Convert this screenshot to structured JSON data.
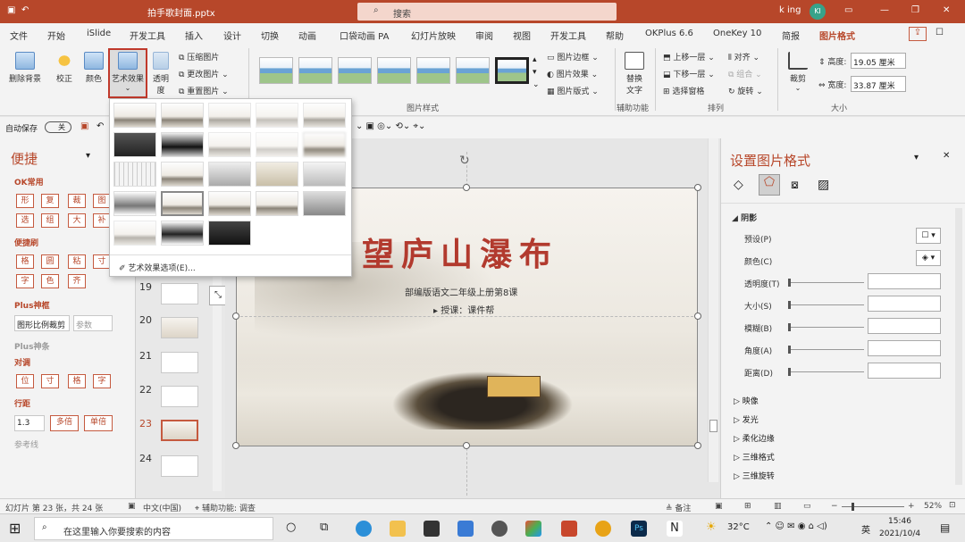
{
  "titlebar": {
    "filename": "拍手歌封面.pptx",
    "search_placeholder": "搜索",
    "user": "k ing",
    "avatar": "KI"
  },
  "menu": [
    "文件",
    "开始",
    "iSlide",
    "开发工具",
    "插入",
    "设计",
    "切换",
    "动画",
    "口袋动画 PA",
    "幻灯片放映",
    "审阅",
    "视图",
    "开发工具",
    "帮助",
    "OKPlus 6.6",
    "OneKey 10",
    "简报",
    "图片格式"
  ],
  "ribbon": {
    "remove_bg": "删除背景",
    "correct": "校正",
    "color": "颜色",
    "art_effects": "艺术效果",
    "transparency": "透明度",
    "compress": "压缩图片",
    "change": "更改图片",
    "reset": "重置图片",
    "picture_border": "图片边框",
    "picture_effects": "图片效果",
    "picture_layout": "图片版式",
    "alt_text": "替换文字",
    "bring_forward": "上移一层",
    "send_backward": "下移一层",
    "selection_pane": "选择窗格",
    "align": "对齐",
    "group": "组合",
    "rotate": "旋转",
    "crop": "裁剪",
    "height_label": "高度:",
    "height_value": "19.05 厘米",
    "width_label": "宽度:",
    "width_value": "33.87 厘米",
    "group_styles": "图片样式",
    "group_accessibility": "辅助功能",
    "group_arrange": "排列",
    "group_size": "大小"
  },
  "qat": {
    "autosave": "自动保存",
    "toggle": "关"
  },
  "dropdown": {
    "option_label": "艺术效果选项(E)..."
  },
  "leftpane": {
    "title": "便捷",
    "sec1": "OK常用",
    "row1": [
      "形",
      "复",
      "裁",
      "图"
    ],
    "row2": [
      "选",
      "组",
      "大",
      "补"
    ],
    "sec2": "便捷刷",
    "row3": [
      "格",
      "圆",
      "粘",
      "寸"
    ],
    "row4": [
      "字",
      "色",
      "齐"
    ],
    "sec3": "Plus神框",
    "crop_ratio": "图形比例裁剪",
    "param_placeholder": "参数",
    "sec4": "Plus神条",
    "sec5": "对调",
    "row5": [
      "位",
      "寸",
      "格",
      "字"
    ],
    "sec6": "行距",
    "spacing_value": "1.3",
    "multi": "多倍",
    "single": "单倍",
    "ref": "参考线"
  },
  "thumbnails": [
    "19",
    "20",
    "21",
    "22",
    "23",
    "24"
  ],
  "slide": {
    "title": "望庐山瀑布",
    "subtitle": "部编版语文二年级上册第8课",
    "teacher": "授课：课件帮"
  },
  "rightpane": {
    "title": "设置图片格式",
    "shadow": "阴影",
    "preset": "预设(P)",
    "color": "颜色(C)",
    "transparency": "透明度(T)",
    "size": "大小(S)",
    "blur": "模糊(B)",
    "angle": "角度(A)",
    "distance": "距离(D)",
    "reflection": "映像",
    "glow": "发光",
    "soft_edges": "柔化边缘",
    "format_3d": "三维格式",
    "rotation_3d": "三维旋转"
  },
  "statusbar": {
    "slide_info": "幻灯片 第 23 张，共 24 张",
    "language": "中文(中国)",
    "accessibility": "辅助功能: 调查",
    "notes": "备注",
    "zoom": "52%"
  },
  "taskbar": {
    "search": "在这里输入你要搜索的内容",
    "temp": "32°C",
    "ime": "英",
    "time": "15:46",
    "date": "2021/10/4"
  }
}
